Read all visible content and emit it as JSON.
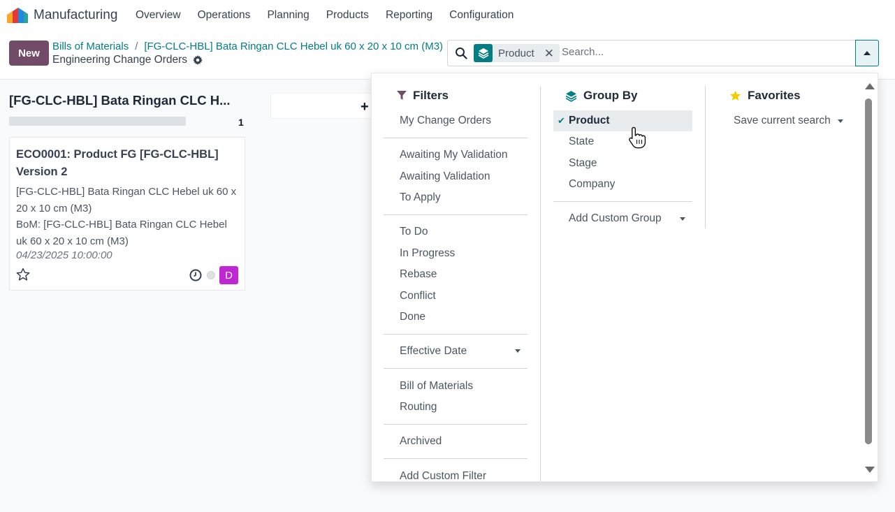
{
  "app": {
    "name": "Manufacturing"
  },
  "nav": {
    "items": [
      "Overview",
      "Operations",
      "Planning",
      "Products",
      "Reporting",
      "Configuration"
    ]
  },
  "control": {
    "new_label": "New",
    "breadcrumb": [
      "Bills of Materials",
      "[FG-CLC-HBL] Bata Ringan CLC Hebel uk 60 x 20 x 10 cm (M3)"
    ],
    "breadcrumb_sep": "/",
    "subtitle": "Engineering Change Orders"
  },
  "search": {
    "facet_label": "Product",
    "facet_remove": "✕",
    "placeholder": "Search..."
  },
  "kanban": {
    "column_title": "[FG-CLC-HBL] Bata Ringan CLC H...",
    "column_count": "1",
    "quick_add": "+",
    "card": {
      "title": "ECO0001: Product FG [FG-CLC-HBL] Version 2",
      "product_line1": "[FG-CLC-HBL] Bata Ringan CLC Hebel uk 60 x",
      "product_line2": "20 x 10 cm (M3)",
      "bom_line1": "BoM: [FG-CLC-HBL] Bata Ringan CLC Hebel",
      "bom_line2": "uk 60 x 20 x 10 cm (M3)",
      "date": "04/23/2025 10:00:00",
      "avatar_initial": "D"
    }
  },
  "dropdown": {
    "filters": {
      "title": "Filters",
      "groups": [
        [
          "My Change Orders"
        ],
        [
          "Awaiting My Validation",
          "Awaiting Validation",
          "To Apply"
        ],
        [
          "To Do",
          "In Progress",
          "Rebase",
          "Conflict",
          "Done"
        ],
        [
          "Effective Date"
        ],
        [
          "Bill of Materials",
          "Routing"
        ],
        [
          "Archived"
        ],
        [
          "Add Custom Filter"
        ]
      ]
    },
    "groupby": {
      "title": "Group By",
      "options": [
        "Product",
        "State",
        "Stage",
        "Company"
      ],
      "selected_check": "✔",
      "custom": "Add Custom Group"
    },
    "favorites": {
      "title": "Favorites",
      "save": "Save current search"
    }
  },
  "colors": {
    "brand": "#714B67",
    "accent": "#017e84",
    "avatar": "#c026d3",
    "star": "#f3cc00"
  }
}
